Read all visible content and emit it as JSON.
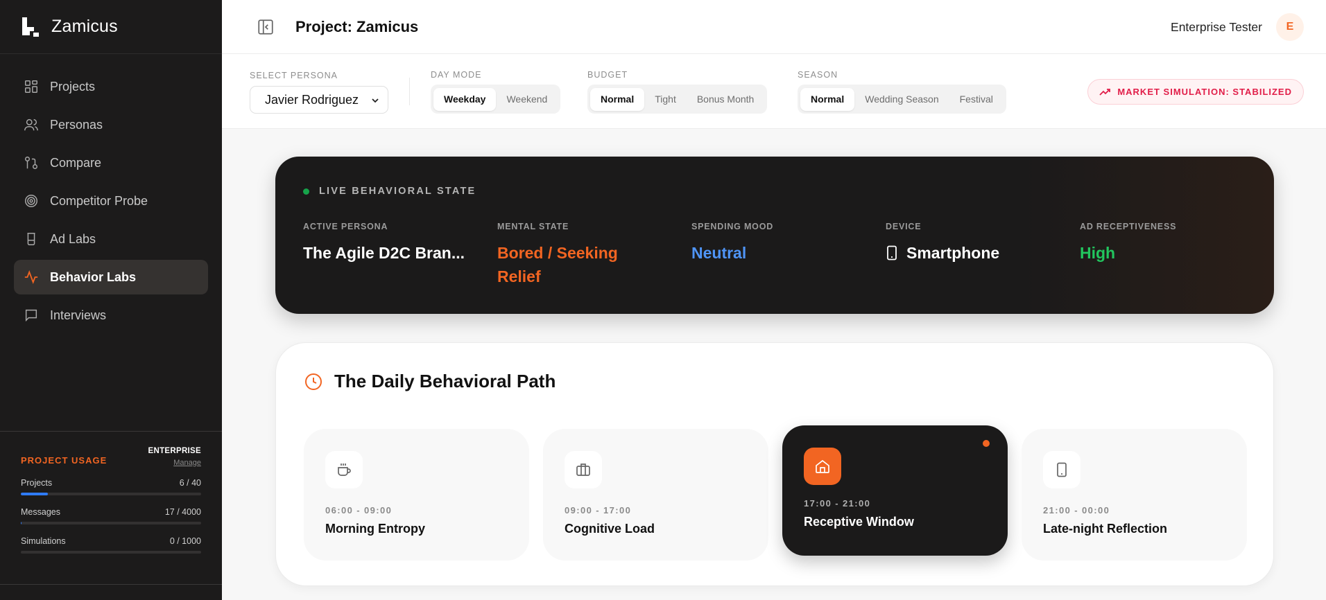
{
  "brand": {
    "name": "Zamicus"
  },
  "nav": {
    "items": [
      {
        "label": "Projects",
        "icon": "grid-icon"
      },
      {
        "label": "Personas",
        "icon": "users-icon"
      },
      {
        "label": "Compare",
        "icon": "compare-icon"
      },
      {
        "label": "Competitor Probe",
        "icon": "target-icon"
      },
      {
        "label": "Ad Labs",
        "icon": "flask-icon"
      },
      {
        "label": "Behavior Labs",
        "icon": "pulse-icon",
        "active": true
      },
      {
        "label": "Interviews",
        "icon": "chat-icon"
      }
    ]
  },
  "usage": {
    "title": "PROJECT USAGE",
    "plan": "ENTERPRISE",
    "manage": "Manage",
    "meters": [
      {
        "label": "Projects",
        "value": "6 / 40",
        "fraction": 0.15
      },
      {
        "label": "Messages",
        "value": "17 / 4000",
        "fraction": 0.004
      },
      {
        "label": "Simulations",
        "value": "0 / 1000",
        "fraction": 0
      }
    ]
  },
  "header": {
    "title": "Project: Zamicus",
    "user_name": "Enterprise Tester",
    "avatar_initial": "E"
  },
  "controls": {
    "persona_label": "SELECT PERSONA",
    "persona_value": "Javier Rodriguez",
    "day_mode_label": "DAY MODE",
    "day_mode_options": [
      "Weekday",
      "Weekend"
    ],
    "day_mode_selected": "Weekday",
    "budget_label": "BUDGET",
    "budget_options": [
      "Normal",
      "Tight",
      "Bonus Month"
    ],
    "budget_selected": "Normal",
    "season_label": "SEASON",
    "season_options": [
      "Normal",
      "Wedding Season",
      "Festival"
    ],
    "season_selected": "Normal",
    "simulation_status": "MARKET SIMULATION: STABILIZED"
  },
  "live_state": {
    "title": "LIVE BEHAVIORAL STATE",
    "active_persona_label": "ACTIVE PERSONA",
    "active_persona": "The Agile D2C Bran...",
    "mental_state_label": "MENTAL STATE",
    "mental_state": "Bored / Seeking Relief",
    "spending_mood_label": "SPENDING MOOD",
    "spending_mood": "Neutral",
    "device_label": "DEVICE",
    "device": "Smartphone",
    "ad_receptiveness_label": "AD RECEPTIVENESS",
    "ad_receptiveness": "High",
    "colors": {
      "mental_state": "#f26522",
      "spending_mood": "#4f94f5",
      "ad_receptiveness": "#22c55e"
    }
  },
  "daily_path": {
    "title": "The Daily Behavioral Path",
    "slots": [
      {
        "time": "06:00 - 09:00",
        "name": "Morning Entropy",
        "icon": "coffee-icon"
      },
      {
        "time": "09:00 - 17:00",
        "name": "Cognitive Load",
        "icon": "briefcase-icon"
      },
      {
        "time": "17:00 - 21:00",
        "name": "Receptive Window",
        "icon": "home-icon",
        "active": true
      },
      {
        "time": "21:00 - 00:00",
        "name": "Late-night Reflection",
        "icon": "smartphone-icon"
      }
    ]
  },
  "theme": {
    "accent": "#f26522",
    "sidebar_bg": "#1c1b1b",
    "alert": "#e11d48"
  }
}
